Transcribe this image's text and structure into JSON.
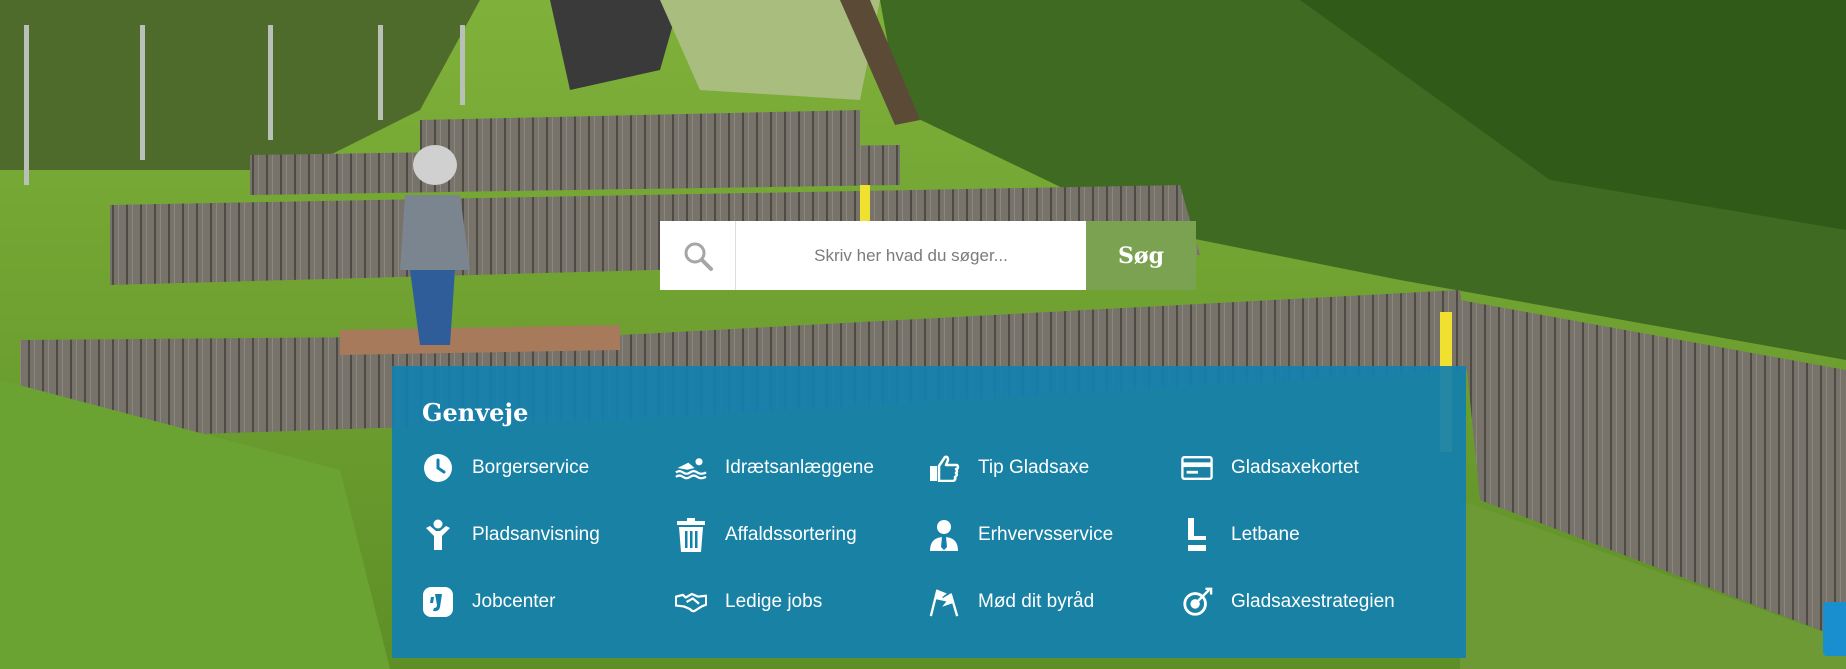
{
  "search": {
    "placeholder": "Skriv her hvad du søger...",
    "button_label": "Søg"
  },
  "genveje": {
    "title": "Genveje",
    "items": [
      {
        "label": "Borgerservice",
        "icon": "clock-icon"
      },
      {
        "label": "Idrætsanlæggene",
        "icon": "swimmer-icon"
      },
      {
        "label": "Tip Gladsaxe",
        "icon": "pointing-hand-icon"
      },
      {
        "label": "Gladsaxekortet",
        "icon": "card-icon"
      },
      {
        "label": "Pladsanvisning",
        "icon": "child-icon"
      },
      {
        "label": "Affaldssortering",
        "icon": "trash-icon"
      },
      {
        "label": "Erhvervsservice",
        "icon": "businessman-icon"
      },
      {
        "label": "Letbane",
        "icon": "letbane-icon"
      },
      {
        "label": "Jobcenter",
        "icon": "jobcenter-icon"
      },
      {
        "label": "Ledige jobs",
        "icon": "handshake-icon"
      },
      {
        "label": "Mød dit byråd",
        "icon": "flags-icon"
      },
      {
        "label": "Gladsaxestrategien",
        "icon": "strategy-icon"
      }
    ]
  },
  "colors": {
    "panel": "#1280af",
    "search_button": "#7aa251"
  }
}
